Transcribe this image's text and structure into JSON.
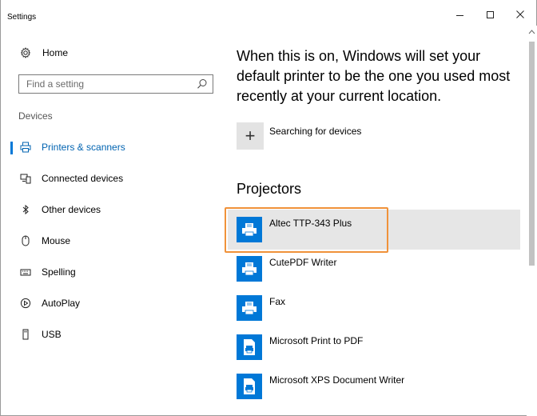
{
  "window": {
    "title": "Settings",
    "minimize_icon": "minimize-icon",
    "maximize_icon": "maximize-icon",
    "close_icon": "close-icon"
  },
  "sidebar": {
    "home_label": "Home",
    "home_icon": "gear-icon",
    "search_placeholder": "Find a setting",
    "search_icon": "search-icon",
    "section_label": "Devices",
    "items": [
      {
        "label": "Printers & scanners",
        "icon": "printer-icon",
        "active": true
      },
      {
        "label": "Connected devices",
        "icon": "connected-devices-icon",
        "active": false
      },
      {
        "label": "Other devices",
        "icon": "bluetooth-icon",
        "active": false
      },
      {
        "label": "Mouse",
        "icon": "mouse-icon",
        "active": false
      },
      {
        "label": "Spelling",
        "icon": "keyboard-icon",
        "active": false
      },
      {
        "label": "AutoPlay",
        "icon": "autoplay-icon",
        "active": false
      },
      {
        "label": "USB",
        "icon": "usb-icon",
        "active": false
      }
    ]
  },
  "main": {
    "description": "When this is on, Windows will set your default printer to be the one you used most recently at your current location.",
    "searching_label": "Searching for devices",
    "searching_icon": "plus-icon",
    "projectors_heading": "Projectors",
    "devices": [
      {
        "label": "Altec TTP-343 Plus",
        "icon": "printer-device-icon",
        "selected": true
      },
      {
        "label": "CutePDF Writer",
        "icon": "printer-device-icon",
        "selected": false
      },
      {
        "label": "Fax",
        "icon": "printer-device-icon",
        "selected": false
      },
      {
        "label": "Microsoft Print to PDF",
        "icon": "print-to-file-icon",
        "selected": false
      },
      {
        "label": "Microsoft XPS Document Writer",
        "icon": "print-to-file-icon",
        "selected": false
      }
    ]
  },
  "colors": {
    "accent": "#0078d7",
    "active_text": "#0063b1",
    "selected_bg": "#e6e6e6",
    "highlight": "#f0923a"
  }
}
